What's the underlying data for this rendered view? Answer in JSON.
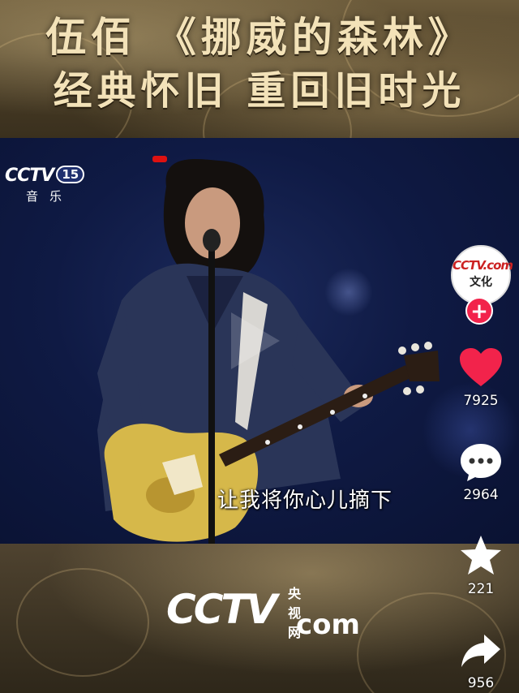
{
  "banner": {
    "line1": "伍佰 《挪威的森林》",
    "line2": "经典怀旧  重回旧时光"
  },
  "video": {
    "channel_logo": "CCTV",
    "channel_number": "15",
    "channel_sub": "音乐",
    "subtitle": "让我将你心儿摘下"
  },
  "watermark": {
    "logo": "CCTV",
    "com": "com",
    "cn": "央视网"
  },
  "rail": {
    "avatar_top": "CCTV.com",
    "avatar_bottom": "文化",
    "follow_label": "+",
    "like_count": "7925",
    "comment_count": "2964",
    "favorite_count": "221",
    "share_count": "956"
  },
  "colors": {
    "like": "#f2234b",
    "accent_gold": "#f3e2b8",
    "follow": "#f2234b"
  },
  "icons": [
    "heart-icon",
    "comment-icon",
    "star-icon",
    "share-icon",
    "plus-icon"
  ]
}
